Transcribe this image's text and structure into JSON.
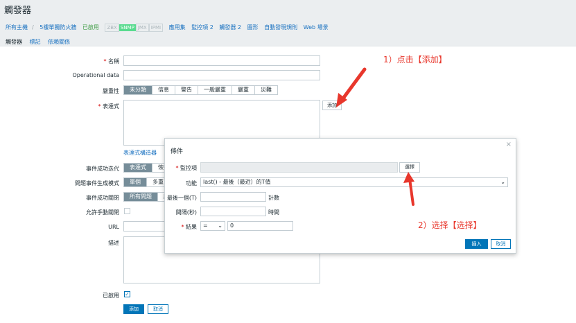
{
  "page": {
    "title": "觸發器"
  },
  "breadcrumb": {
    "all_hosts": "所有主機",
    "host": "5樓單獨防火牆",
    "enabled": "已啟用",
    "zbx": "ZBX",
    "snmp": "SNMP",
    "jmx": "JMX",
    "ipmi": "IPMI",
    "applications": "應用集",
    "items": "監控項 2",
    "triggers": "觸發器 2",
    "graphs": "圖形",
    "discovery": "自動發現規則",
    "web": "Web 場景"
  },
  "tabs": [
    "觸發器",
    "標記",
    "依賴關係"
  ],
  "form": {
    "name_label": "名稱",
    "opdata_label": "Operational data",
    "severity_label": "嚴重性",
    "severity_options": [
      "未分類",
      "信息",
      "警告",
      "一般嚴重",
      "嚴重",
      "災難"
    ],
    "expression_label": "表達式",
    "add_label": "添加",
    "constructor_label": "表達式構造器",
    "ok_event_label": "事件成功迭代",
    "ok_event_opts": [
      "表達式",
      "恢復"
    ],
    "problem_mode_label": "問題事件生成模式",
    "problem_mode_opts": [
      "單個",
      "多重"
    ],
    "ok_close_label": "事件成功關閉",
    "ok_close_opts": [
      "所有問題",
      "所"
    ],
    "manual_close_label": "允許手動關閉",
    "url_label": "URL",
    "desc_label": "描述",
    "enabled_label": "已啟用",
    "submit_label": "添加",
    "cancel_label": "取消"
  },
  "modal": {
    "title": "條件",
    "item_label": "監控項",
    "select_label": "選擇",
    "function_label": "功能",
    "function_value": "last() - 最後（最近）的T值",
    "last_label": "最後一個(T)",
    "count_label": "計數",
    "interval_label": "間隔(秒)",
    "time_label": "時間",
    "result_label": "結果",
    "operator_value": "=",
    "result_value": "0",
    "insert_label": "插入",
    "cancel_label": "取消",
    "close_glyph": "×"
  },
  "annotations": {
    "step1": "1）点击【添加】",
    "step2": "2）选择【选择】",
    "color": "#e8372c"
  }
}
